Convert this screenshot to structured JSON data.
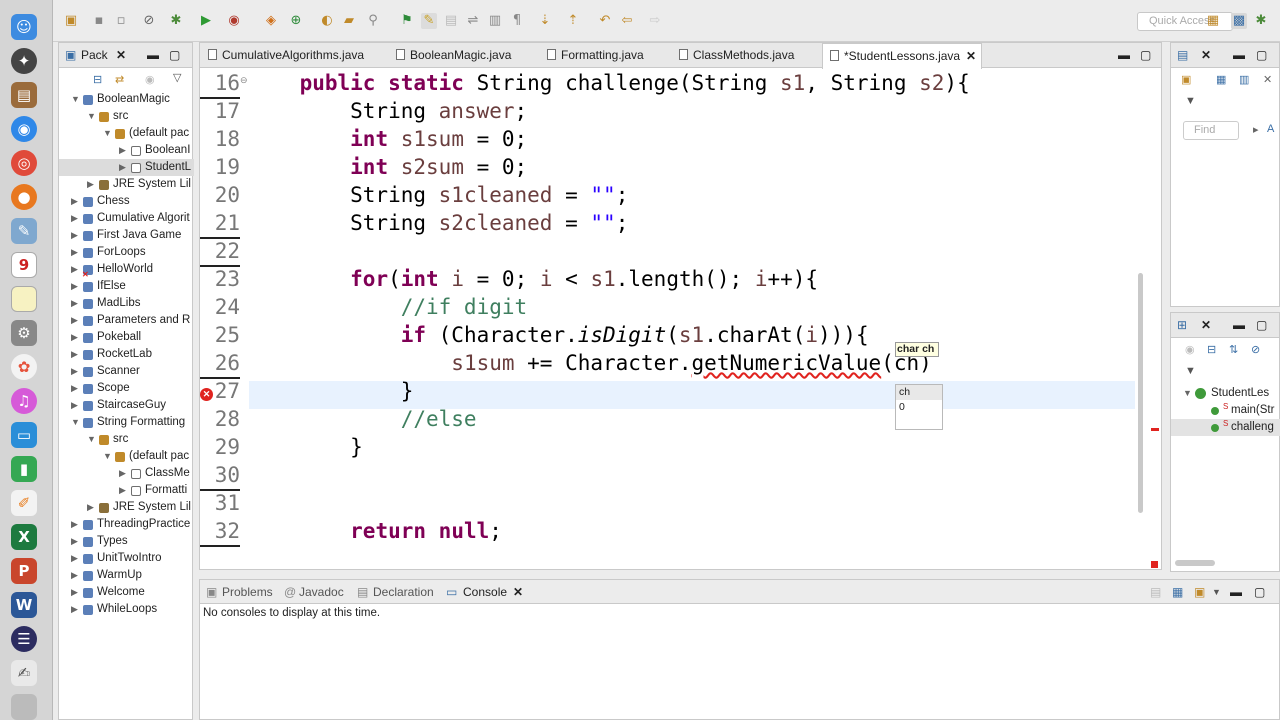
{
  "toolbar": {
    "quick_access": "Quick Access"
  },
  "package_explorer": {
    "tab_label": "Pack",
    "tree": [
      {
        "label": "BooleanMagic",
        "depth": 0,
        "expanded": true,
        "kind": "project"
      },
      {
        "label": "src",
        "depth": 1,
        "expanded": true,
        "kind": "folder"
      },
      {
        "label": "(default pac",
        "depth": 2,
        "expanded": true,
        "kind": "package"
      },
      {
        "label": "BooleanI",
        "depth": 3,
        "expanded": false,
        "kind": "file"
      },
      {
        "label": "StudentL",
        "depth": 3,
        "expanded": false,
        "kind": "file",
        "selected": true
      },
      {
        "label": "JRE System Lil",
        "depth": 1,
        "expanded": false,
        "kind": "lib"
      },
      {
        "label": "Chess",
        "depth": 0,
        "expanded": false,
        "kind": "project"
      },
      {
        "label": "Cumulative Algorit",
        "depth": 0,
        "expanded": false,
        "kind": "project"
      },
      {
        "label": "First Java Game",
        "depth": 0,
        "expanded": false,
        "kind": "project"
      },
      {
        "label": "ForLoops",
        "depth": 0,
        "expanded": false,
        "kind": "project"
      },
      {
        "label": "HelloWorld",
        "depth": 0,
        "expanded": false,
        "kind": "project",
        "error": true
      },
      {
        "label": "IfElse",
        "depth": 0,
        "expanded": false,
        "kind": "project"
      },
      {
        "label": "MadLibs",
        "depth": 0,
        "expanded": false,
        "kind": "project"
      },
      {
        "label": "Parameters and R",
        "depth": 0,
        "expanded": false,
        "kind": "project"
      },
      {
        "label": "Pokeball",
        "depth": 0,
        "expanded": false,
        "kind": "project"
      },
      {
        "label": "RocketLab",
        "depth": 0,
        "expanded": false,
        "kind": "project"
      },
      {
        "label": "Scanner",
        "depth": 0,
        "expanded": false,
        "kind": "project"
      },
      {
        "label": "Scope",
        "depth": 0,
        "expanded": false,
        "kind": "project"
      },
      {
        "label": "StaircaseGuy",
        "depth": 0,
        "expanded": false,
        "kind": "project"
      },
      {
        "label": "String Formatting",
        "depth": 0,
        "expanded": true,
        "kind": "project"
      },
      {
        "label": "src",
        "depth": 1,
        "expanded": true,
        "kind": "folder"
      },
      {
        "label": "(default pac",
        "depth": 2,
        "expanded": true,
        "kind": "package"
      },
      {
        "label": "ClassMe",
        "depth": 3,
        "expanded": false,
        "kind": "file"
      },
      {
        "label": "Formatti",
        "depth": 3,
        "expanded": false,
        "kind": "file"
      },
      {
        "label": "JRE System Lil",
        "depth": 1,
        "expanded": false,
        "kind": "lib"
      },
      {
        "label": "ThreadingPractice",
        "depth": 0,
        "expanded": false,
        "kind": "project"
      },
      {
        "label": "Types",
        "depth": 0,
        "expanded": false,
        "kind": "project"
      },
      {
        "label": "UnitTwoIntro",
        "depth": 0,
        "expanded": false,
        "kind": "project"
      },
      {
        "label": "WarmUp",
        "depth": 0,
        "expanded": false,
        "kind": "project"
      },
      {
        "label": "Welcome",
        "depth": 0,
        "expanded": false,
        "kind": "project"
      },
      {
        "label": "WhileLoops",
        "depth": 0,
        "expanded": false,
        "kind": "project"
      }
    ]
  },
  "editor": {
    "tabs": [
      {
        "label": "CumulativeAlgorithms.java",
        "active": false
      },
      {
        "label": "BooleanMagic.java",
        "active": false
      },
      {
        "label": "Formatting.java",
        "active": false
      },
      {
        "label": "ClassMethods.java",
        "active": false
      },
      {
        "label": "*StudentLessons.java",
        "active": true
      }
    ],
    "line_numbers": [
      "16",
      "17",
      "18",
      "19",
      "20",
      "21",
      "22",
      "23",
      "24",
      "25",
      "26",
      "27",
      "28",
      "29",
      "30",
      "31",
      "32"
    ],
    "lines": [
      "    public static String challenge(String s1, String s2){",
      "        String answer;",
      "        int s1sum = 0;",
      "        int s2sum = 0;",
      "        String s1cleaned = \"\";",
      "        String s2cleaned = \"\";",
      "",
      "        for(int i = 0; i < s1.length(); i++){",
      "            //if digit",
      "            if (Character.isDigit(s1.charAt(i))){",
      "                s1sum += Character.getNumericValue(ch)",
      "            }",
      "            //else",
      "        }",
      "",
      "",
      "        return null;"
    ],
    "param_hint": "char ch",
    "completion": [
      "ch",
      "0"
    ]
  },
  "bottom_panel": {
    "tabs": [
      "Problems",
      "Javadoc",
      "Declaration",
      "Console"
    ],
    "active_tab": "Console",
    "message": "No consoles to display at this time."
  },
  "outline_panel": {
    "find_placeholder": "Find",
    "find_toggle": "A"
  },
  "outline_tree": {
    "class_name": "StudentLes",
    "members": [
      "main(Str",
      "challeng"
    ]
  }
}
